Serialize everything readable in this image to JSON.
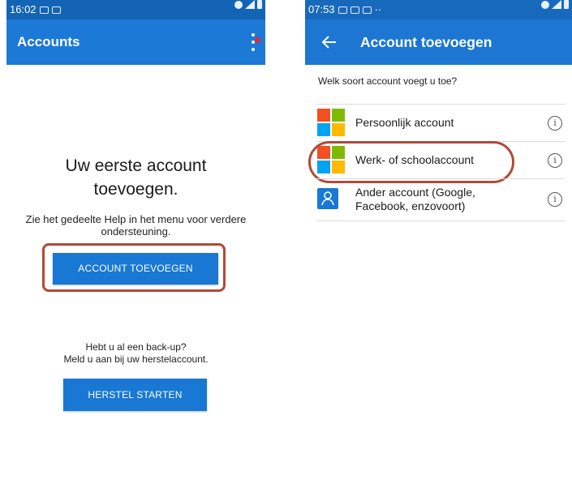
{
  "left_screen": {
    "status_time": "16:02",
    "app_title": "Accounts",
    "empty_title": "Uw eerste account toevoegen.",
    "help_text": "Zie het gedeelte Help in het menu voor verdere ondersteuning.",
    "add_account_button": "ACCOUNT TOEVOEGEN",
    "backup_line1": "Hebt u al een back-up?",
    "backup_line2": "Meld u aan bij uw herstelaccount.",
    "restore_button": "HERSTEL STARTEN",
    "notification_dot_color": "#e22a3d"
  },
  "right_screen": {
    "status_time": "07:53",
    "status_extra": "··",
    "app_title": "Account toevoegen",
    "question": "Welk soort account voegt u toe?",
    "options": [
      {
        "label": "Persoonlijk account",
        "icon": "microsoft-logo-icon",
        "info_icon": "info-icon"
      },
      {
        "label": "Werk- of schoolaccount",
        "icon": "microsoft-logo-icon",
        "info_icon": "info-icon",
        "highlighted": true
      },
      {
        "label": "Ander account (Google, Facebook, enzovoort)",
        "icon": "person-icon",
        "info_icon": "info-icon"
      }
    ]
  },
  "colors": {
    "app_bar": "#1d79d6",
    "button": "#1878d3",
    "highlight": "#b24a37",
    "ms_red": "#f25022",
    "ms_green": "#7fba00",
    "ms_blue": "#00a4ef",
    "ms_yellow": "#ffb900"
  }
}
